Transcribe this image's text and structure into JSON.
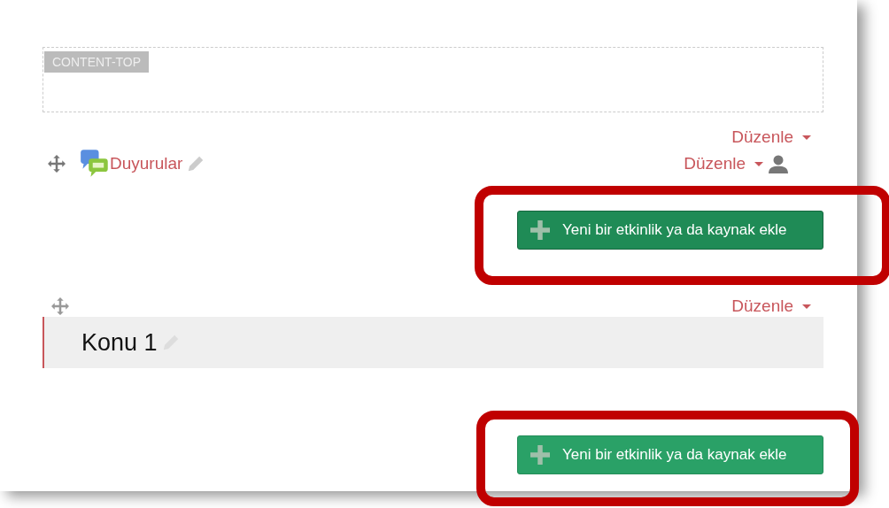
{
  "block_region": {
    "label": "CONTENT-TOP"
  },
  "sections": [
    {
      "kind": "general",
      "edit_menu": "Düzenle",
      "activities": [
        {
          "name": "Duyurular",
          "edit_menu": "Düzenle"
        }
      ],
      "add_button": {
        "label": "Yeni bir etkinlik ya da kaynak ekle",
        "highlighted": true
      }
    },
    {
      "kind": "topic",
      "title": "Konu 1",
      "edit_menu": "Düzenle",
      "add_button": {
        "label": "Yeni bir etkinlik ya da kaynak ekle",
        "highlighted": true
      }
    }
  ]
}
